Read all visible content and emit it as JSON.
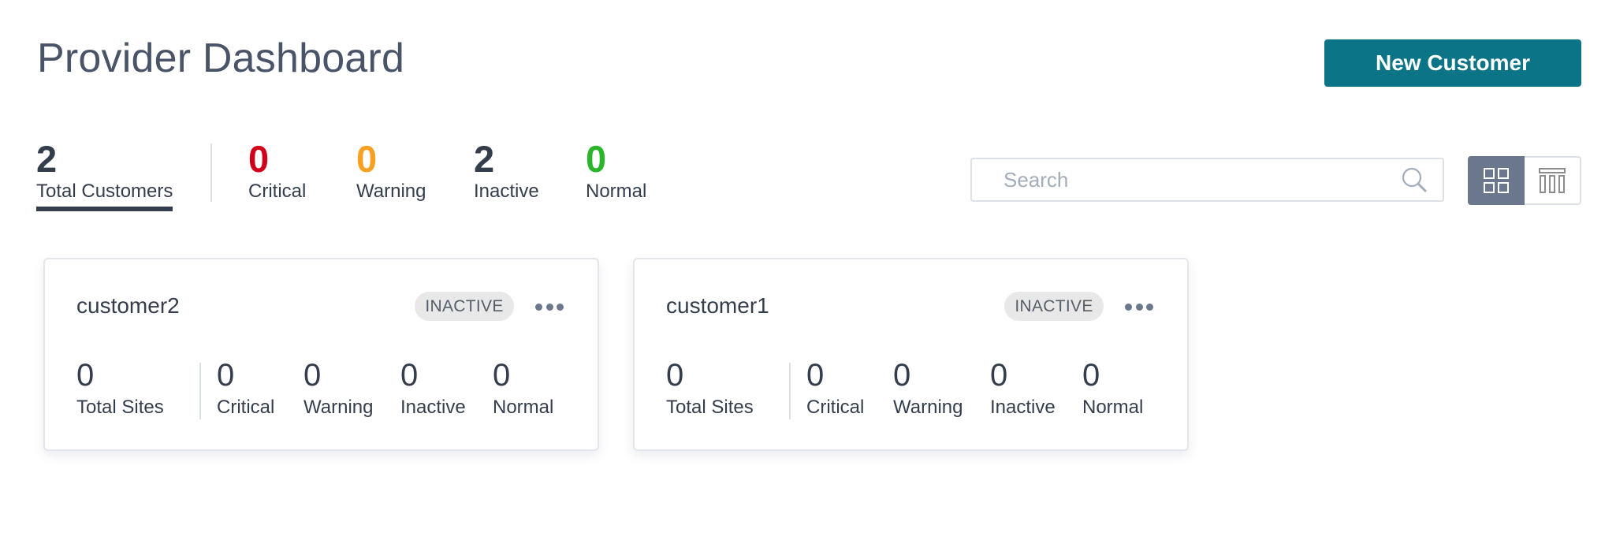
{
  "header": {
    "title": "Provider Dashboard",
    "new_customer_label": "New Customer"
  },
  "colors": {
    "accent": "#0b7587",
    "critical": "#d0021b",
    "warning": "#f7a021",
    "inactive": "#343d4c",
    "normal": "#2ab52a",
    "total": "#343d4c"
  },
  "summary": {
    "total": {
      "value": "2",
      "label": "Total Customers",
      "active": true
    },
    "critical": {
      "value": "0",
      "label": "Critical"
    },
    "warning": {
      "value": "0",
      "label": "Warning"
    },
    "inactive": {
      "value": "2",
      "label": "Inactive"
    },
    "normal": {
      "value": "0",
      "label": "Normal"
    }
  },
  "search": {
    "placeholder": "Search",
    "value": "",
    "icon": "search-icon"
  },
  "view_toggle": {
    "selected": "grid",
    "options": [
      {
        "id": "grid",
        "icon": "grid-view-icon"
      },
      {
        "id": "list",
        "icon": "table-view-icon"
      }
    ]
  },
  "customers": [
    {
      "name": "customer2",
      "status": "INACTIVE",
      "menu_icon": "more-icon",
      "stats": {
        "total_sites": {
          "value": "0",
          "label": "Total Sites"
        },
        "critical": {
          "value": "0",
          "label": "Critical"
        },
        "warning": {
          "value": "0",
          "label": "Warning"
        },
        "inactive": {
          "value": "0",
          "label": "Inactive"
        },
        "normal": {
          "value": "0",
          "label": "Normal"
        }
      }
    },
    {
      "name": "customer1",
      "status": "INACTIVE",
      "menu_icon": "more-icon",
      "stats": {
        "total_sites": {
          "value": "0",
          "label": "Total Sites"
        },
        "critical": {
          "value": "0",
          "label": "Critical"
        },
        "warning": {
          "value": "0",
          "label": "Warning"
        },
        "inactive": {
          "value": "0",
          "label": "Inactive"
        },
        "normal": {
          "value": "0",
          "label": "Normal"
        }
      }
    }
  ]
}
